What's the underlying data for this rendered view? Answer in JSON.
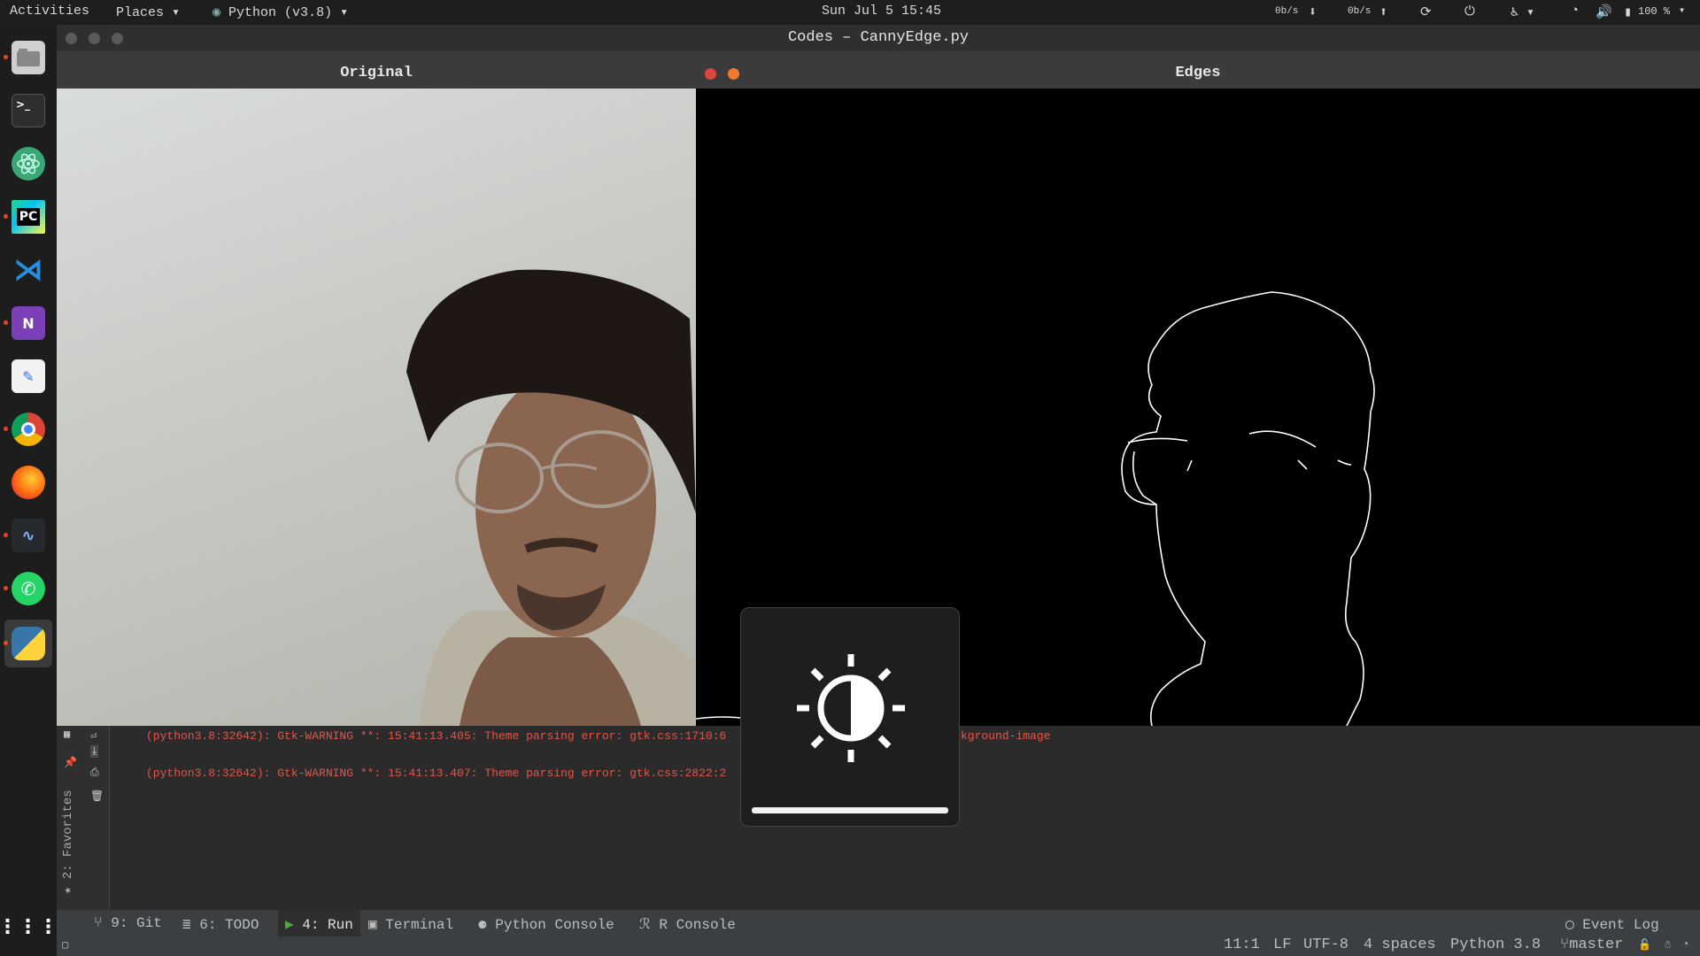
{
  "topbar": {
    "activities": "Activities",
    "places": "Places",
    "app_menu": "Python (v3.8)",
    "clock": "Sun Jul 5 15:45",
    "net_down": "0b/s",
    "net_up": "0b/s",
    "battery": "100 %"
  },
  "ide": {
    "title": "Codes – CannyEdge.py"
  },
  "windows": {
    "original_title": "Original",
    "edges_title": "Edges"
  },
  "console": {
    "lines": [
      "(python3.8:32642): Gtk-WARNING **: 15:41:13.405: Theme parsing error: gtk.css:1710:6",
      "(python3.8:32642): Gtk-WARNING **: 15:41:13.407: Theme parsing error: gtk.css:2822:2"
    ],
    "line1_tail": "kground-image",
    "favorites": "2: Favorites"
  },
  "bottom_tabs": {
    "git": "9: Git",
    "todo": "6: TODO",
    "run": "4: Run",
    "terminal": "Terminal",
    "python_console": "Python Console",
    "r_console": "R Console",
    "event_log": "Event Log"
  },
  "status": {
    "position": "11:1",
    "line_sep": "LF",
    "encoding": "UTF-8",
    "indent": "4 spaces",
    "interpreter": "Python 3.8",
    "branch": "master"
  },
  "osd": {
    "icon": "brightness-icon",
    "level": 1.0
  },
  "dock_icons": [
    "files-icon",
    "terminal-icon",
    "atom-icon",
    "pycharm-icon",
    "vscode-icon",
    "onenote-icon",
    "text-editor-icon",
    "chrome-icon",
    "firefox-icon",
    "system-monitor-icon",
    "whatsapp-icon",
    "python-icon",
    "app-grid-icon"
  ],
  "colors": {
    "accent_red": "#e2564a",
    "close_red": "#e0443e",
    "minimize_orange": "#f07b2e"
  }
}
